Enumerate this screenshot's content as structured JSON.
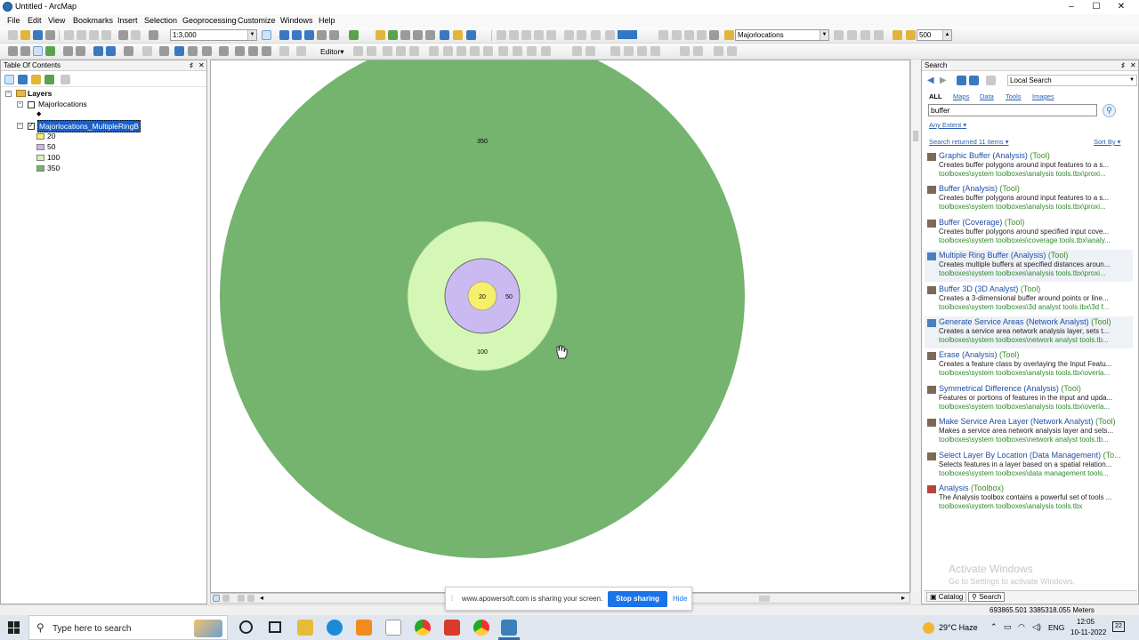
{
  "window": {
    "title": "Untitled - ArcMap",
    "controls": [
      "–",
      "☐",
      "✕"
    ]
  },
  "menu": [
    "File",
    "Edit",
    "View",
    "Bookmarks",
    "Insert",
    "Selection",
    "Geoprocessing",
    "Customize",
    "Windows",
    "Help"
  ],
  "toolbar": {
    "scale": "1:3,000",
    "editor_label": "Editor",
    "layer_select": "Majorlocations",
    "buffer_value": "500"
  },
  "toc": {
    "header": "Table Of Contents",
    "pin": "♯",
    "close": "✕",
    "root": "Layers",
    "layer1": "Majorlocations",
    "layer1_symbol": "◆",
    "layer2": "Majorlocations_MultipleRingB",
    "legend": [
      {
        "label": "20",
        "color": "#f4f06a"
      },
      {
        "label": "50",
        "color": "#c8b8f0"
      },
      {
        "label": "100",
        "color": "#d4f5b4"
      },
      {
        "label": "350",
        "color": "#74b46e"
      }
    ]
  },
  "map": {
    "rings": [
      {
        "label": "350",
        "color": "#74b46e"
      },
      {
        "label": "100",
        "color": "#d5f7b5"
      },
      {
        "label": "50",
        "color": "#cbb9f2"
      },
      {
        "label": "20",
        "color": "#f5f06a"
      }
    ]
  },
  "search": {
    "header": "Search",
    "scope": "Local Search",
    "filters": [
      "ALL",
      "Maps",
      "Data",
      "Tools",
      "Images"
    ],
    "query": "buffer",
    "extent": "Any Extent",
    "count_text": "Search returned 11 items",
    "sort_text": "Sort By",
    "results": [
      {
        "name": "Graphic Buffer (Analysis)",
        "kind": "(Tool)",
        "desc": "Creates buffer polygons around input features to a s...",
        "path": "toolboxes\\system toolboxes\\analysis tools.tbx\\proxi..."
      },
      {
        "name": "Buffer (Analysis)",
        "kind": "(Tool)",
        "desc": "Creates buffer polygons around input features to a s...",
        "path": "toolboxes\\system toolboxes\\analysis tools.tbx\\proxi..."
      },
      {
        "name": "Buffer (Coverage)",
        "kind": "(Tool)",
        "desc": "Creates buffer polygons around specified input cove...",
        "path": "toolboxes\\system toolboxes\\coverage tools.tbx\\analy..."
      },
      {
        "name": "Multiple Ring Buffer (Analysis)",
        "kind": "(Tool)",
        "desc": "Creates multiple buffers at specified distances aroun...",
        "path": "toolboxes\\system toolboxes\\analysis tools.tbx\\proxi..."
      },
      {
        "name": "Buffer 3D (3D Analyst)",
        "kind": "(Tool)",
        "desc": "Creates a 3-dimensional buffer around points or line...",
        "path": "toolboxes\\system toolboxes\\3d analyst tools.tbx\\3d f..."
      },
      {
        "name": "Generate Service Areas (Network Analyst)",
        "kind": "(Tool)",
        "desc": "Creates a service area network analysis layer, sets t...",
        "path": "toolboxes\\system toolboxes\\network analyst tools.tb..."
      },
      {
        "name": "Erase (Analysis)",
        "kind": "(Tool)",
        "desc": "Creates a feature class by overlaying the Input Featu...",
        "path": "toolboxes\\system toolboxes\\analysis tools.tbx\\overla..."
      },
      {
        "name": "Symmetrical Difference (Analysis)",
        "kind": "(Tool)",
        "desc": "Features or portions of features in the input and upda...",
        "path": "toolboxes\\system toolboxes\\analysis tools.tbx\\overla..."
      },
      {
        "name": "Make Service Area Layer (Network Analyst)",
        "kind": "(Tool)",
        "desc": "Makes a service area network analysis layer and sets...",
        "path": "toolboxes\\system toolboxes\\network analyst tools.tb..."
      },
      {
        "name": "Select Layer By Location (Data Management)",
        "kind": "(To...",
        "desc": "Selects features in a layer based on a spatial relation...",
        "path": "toolboxes\\system toolboxes\\data management tools..."
      },
      {
        "name": "Analysis",
        "kind": "(Toolbox)",
        "desc": "The Analysis toolbox contains a powerful set of tools ...",
        "path": "toolboxes\\system toolboxes\\analysis tools.tbx"
      }
    ],
    "tabs": [
      "Catalog",
      "Search"
    ],
    "watermark1": "Activate Windows",
    "watermark2": "Go to Settings to activate Windows."
  },
  "sharing": {
    "text": "www.apowersoft.com is sharing your screen.",
    "stop": "Stop sharing",
    "hide": "Hide"
  },
  "status": {
    "coords": "693865.501  3385318.055 Meters"
  },
  "taskbar": {
    "search_placeholder": "Type here to search",
    "weather": "29°C  Haze",
    "lang": "ENG",
    "time": "12:05",
    "date": "10-11-2022",
    "notif": "22"
  }
}
